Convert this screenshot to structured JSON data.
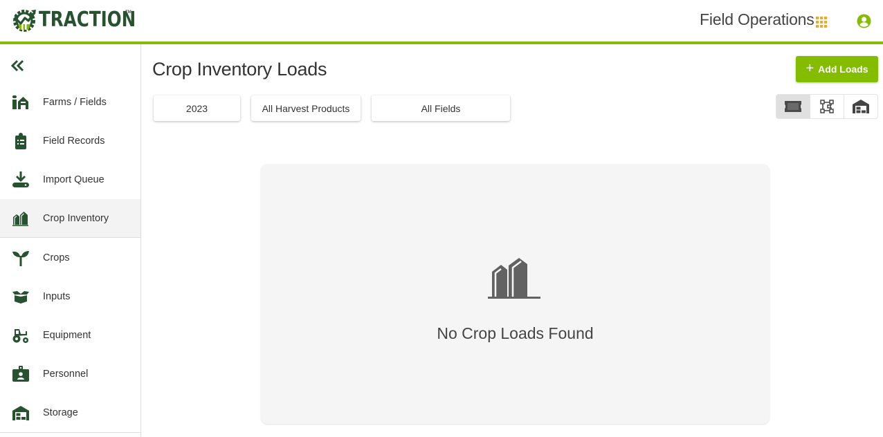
{
  "header": {
    "brand": "TRACTION",
    "trademark": "TM",
    "app_title": "Field Operations",
    "apps_icon": "grid-apps-icon",
    "user_icon": "account-circle-icon",
    "accent_color": "#84bd00",
    "apps_icon_color": "#f5a623"
  },
  "sidebar": {
    "collapse_icon": "double-chevron-left-icon",
    "items": [
      {
        "label": "Farms / Fields",
        "icon": "farm-silo-icon",
        "active": false
      },
      {
        "label": "Field Records",
        "icon": "clipboard-list-icon",
        "active": false
      },
      {
        "label": "Import Queue",
        "icon": "download-tray-icon",
        "active": false
      },
      {
        "label": "Crop Inventory",
        "icon": "grain-bins-icon",
        "active": true
      },
      {
        "label": "Crops",
        "icon": "seedling-icon",
        "active": false
      },
      {
        "label": "Inputs",
        "icon": "open-box-icon",
        "active": false
      },
      {
        "label": "Equipment",
        "icon": "tractor-icon",
        "active": false
      },
      {
        "label": "Personnel",
        "icon": "id-badge-icon",
        "active": false
      },
      {
        "label": "Storage",
        "icon": "warehouse-icon",
        "active": false
      }
    ]
  },
  "main": {
    "title": "Crop Inventory Loads",
    "add_button": {
      "icon": "plus-icon",
      "label": "Add Loads"
    },
    "filters": [
      {
        "label": "2023"
      },
      {
        "label": "All Harvest Products"
      },
      {
        "label": "All Fields"
      }
    ],
    "view_toggle": [
      {
        "icon": "ticket-card-view-icon",
        "active": true
      },
      {
        "icon": "field-boundary-view-icon",
        "active": false
      },
      {
        "icon": "warehouse-view-icon",
        "active": false
      }
    ],
    "empty_state": {
      "icon": "grain-bins-icon",
      "message": "No Crop Loads Found"
    }
  }
}
